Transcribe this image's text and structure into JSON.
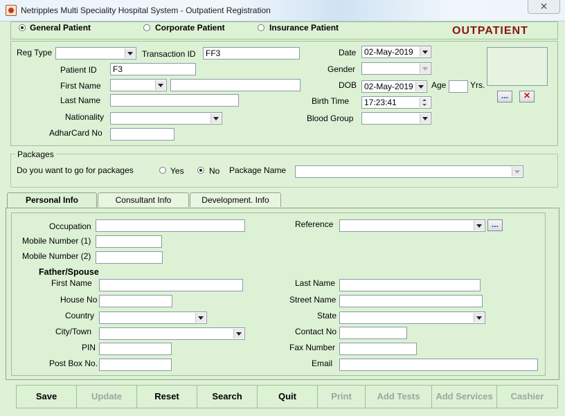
{
  "window": {
    "title": "Netripples Multi Speciality Hospital System - Outpatient Registration",
    "close": "✕"
  },
  "patient_type": {
    "options": [
      "General Patient",
      "Corporate Patient",
      "Insurance Patient"
    ],
    "selected": "General Patient",
    "heading": "OUTPATIENT"
  },
  "registration": {
    "reg_type_label": "Reg Type",
    "reg_type_value": "",
    "transaction_id_label": "Transaction ID",
    "transaction_id_value": "FF3",
    "patient_id_label": "Patient ID",
    "patient_id_value": "F3",
    "first_name_label": "First Name",
    "title_value": "",
    "first_name_value": "",
    "last_name_label": "Last Name",
    "last_name_value": "",
    "nationality_label": "Nationality",
    "nationality_value": "",
    "adharcard_label": "AdharCard No",
    "adharcard_value": "",
    "date_label": "Date",
    "date_value": "02-May-2019",
    "gender_label": "Gender",
    "gender_value": "",
    "dob_label": "DOB",
    "dob_value": "02-May-2019",
    "age_label": "Age",
    "age_value": "",
    "yrs_label": "Yrs.",
    "birth_time_label": "Birth Time",
    "birth_time_value": "17:23:41",
    "blood_group_label": "Blood Group",
    "blood_group_value": "",
    "browse_label": "...",
    "clear_label": "✕"
  },
  "packages": {
    "title": "Packages",
    "question": "Do you want to go for packages",
    "yes_label": "Yes",
    "no_label": "No",
    "selected": "No",
    "package_name_label": "Package Name",
    "package_name_value": ""
  },
  "tabs": [
    {
      "label": "Personal Info",
      "active": true
    },
    {
      "label": "Consultant Info",
      "active": false
    },
    {
      "label": "Development. Info",
      "active": false
    }
  ],
  "personal": {
    "occupation_label": "Occupation",
    "occupation_value": "",
    "reference_label": "Reference",
    "reference_value": "",
    "reference_browse": "...",
    "mobile1_label": "Mobile Number (1)",
    "mobile1_value": "",
    "mobile2_label": "Mobile Number (2)",
    "mobile2_value": "",
    "father_spouse_heading": "Father/Spouse",
    "first_name_label": "First Name",
    "first_name_value": "",
    "last_name_label": "Last Name",
    "last_name_value": "",
    "house_no_label": "House No",
    "house_no_value": "",
    "street_name_label": "Street Name",
    "street_name_value": "",
    "country_label": "Country",
    "country_value": "",
    "state_label": "State",
    "state_value": "",
    "city_label": "City/Town",
    "city_value": "",
    "contact_label": "Contact No",
    "contact_value": "",
    "pin_label": "PIN",
    "pin_value": "",
    "fax_label": "Fax Number",
    "fax_value": "",
    "postbox_label": "Post Box No.",
    "postbox_value": "",
    "email_label": "Email",
    "email_value": ""
  },
  "footer": {
    "save": "Save",
    "update": "Update",
    "reset": "Reset",
    "search": "Search",
    "quit": "Quit",
    "print": "Print",
    "add_tests": "Add Tests",
    "add_services": "Add Services",
    "cashier": "Cashier"
  },
  "colors": {
    "background": "#ddf1d5",
    "heading": "#8b1414",
    "border": "#9fbf94"
  }
}
